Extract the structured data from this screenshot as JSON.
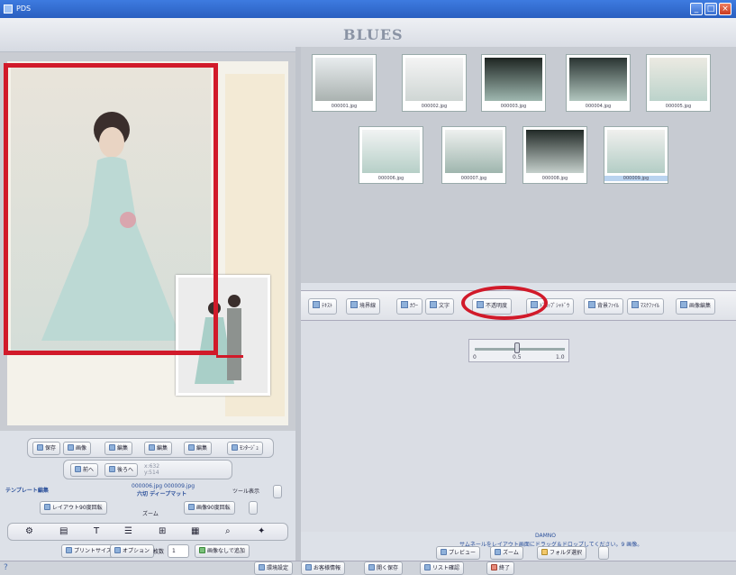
{
  "window": {
    "title": "PDS"
  },
  "header": {
    "logo": "BLUES"
  },
  "thumbnails": [
    {
      "file": "000001.jpg"
    },
    {
      "file": "000002.jpg"
    },
    {
      "file": "000003.jpg"
    },
    {
      "file": "000004.jpg"
    },
    {
      "file": "000005.jpg"
    },
    {
      "file": "000006.jpg"
    },
    {
      "file": "000007.jpg"
    },
    {
      "file": "000008.jpg"
    },
    {
      "file": "000009.jpg"
    }
  ],
  "tabs": [
    "ﾃｷｽﾄ",
    "境界線",
    "ｶﾗｰ",
    "文字",
    "不透明度",
    "ﾄﾞﾛｯﾌﾟｼｬﾄﾞｳ",
    "背景ﾌｧｲﾙ",
    "ﾏｽｸﾌｧｲﾙ",
    "画像編集"
  ],
  "slider": {
    "min": "0",
    "mid": "0.5",
    "max": "1.0"
  },
  "left_toolbar": {
    "row1": [
      "保存",
      "画像",
      "編集",
      "編集",
      "編集",
      "ﾓﾝﾀｰｼﾞｭ"
    ],
    "row2": [
      "前へ",
      "後ろへ"
    ],
    "row2_coords": [
      "x:632",
      "y:514"
    ],
    "template_label": "テンプレート編集",
    "template_files": "000006.jpg  000009.jpg",
    "template_name": "六切 ディープマット",
    "tool_display": "ツール表示",
    "rotate_layout": "レイアウト90度回転",
    "zoom": "ズーム",
    "rotate_image": "画像90度回転",
    "print_size": "プリントサイズ",
    "options": "オプション",
    "copies_label": "枚数",
    "copies_value": "1",
    "add_no_image": "画像なしで追加"
  },
  "right_bottom": {
    "device": "DAMNO",
    "hint": "サムネールをレイアウト画面にドラッグ＆ドロップしてください。9 画像。",
    "preview": "プレビュー",
    "zoom": "ズーム",
    "folder_select": "フォルダ選択"
  },
  "statusbar": [
    "環境設定",
    "お客様情報",
    "開く保存",
    "リスト確認",
    "終了"
  ]
}
